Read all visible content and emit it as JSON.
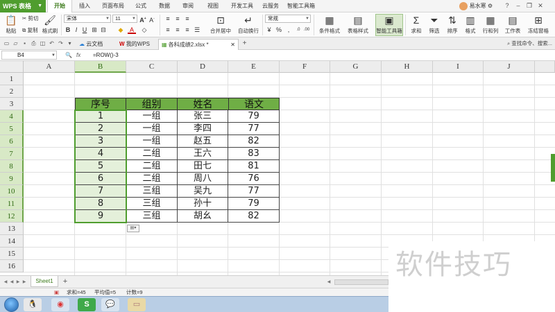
{
  "menubar": {
    "app_button": "WPS 表格",
    "tabs": [
      "开始",
      "插入",
      "页面布局",
      "公式",
      "数据",
      "审阅",
      "视图",
      "开发工具",
      "云服务",
      "智能工具箱"
    ],
    "active_tab": "开始",
    "user": "易水寒"
  },
  "ribbon": {
    "cut": "剪切",
    "copy": "复制",
    "paste": "粘贴",
    "format_painter": "格式刷",
    "font_name": "宋体",
    "font_size": "11",
    "number_format": "常规",
    "merge_center": "合并居中",
    "wrap_text": "自动换行",
    "cond_format": "条件格式",
    "table_style": "表格样式",
    "smart_toolbox": "智能工具箱",
    "sum": "求和",
    "filter": "筛选",
    "sort": "排序",
    "format": "格式",
    "row_col": "行和列",
    "worksheet": "工作表",
    "freeze": "冻结窗格"
  },
  "doc_tabs": {
    "cloud_doc": "云文档",
    "my_wps": "我的WPS",
    "active_file": "各科成绩2.xlsx *",
    "find_command": "查找命令、搜索..."
  },
  "formula_bar": {
    "name_box": "B4",
    "fx": "fx",
    "formula": "=ROW()-3"
  },
  "grid": {
    "columns": [
      "A",
      "B",
      "C",
      "D",
      "E",
      "F",
      "G",
      "H",
      "I",
      "J"
    ],
    "selected_column": "B",
    "rows": [
      "1",
      "2",
      "3",
      "4",
      "5",
      "6",
      "7",
      "8",
      "9",
      "10",
      "11",
      "12",
      "13",
      "14",
      "15",
      "16"
    ],
    "selected_rows": [
      "4",
      "5",
      "6",
      "7",
      "8",
      "9",
      "10",
      "11",
      "12"
    ]
  },
  "table": {
    "headers": [
      "序号",
      "组别",
      "姓名",
      "语文"
    ],
    "rows": [
      [
        "1",
        "一组",
        "张三",
        "79"
      ],
      [
        "2",
        "一组",
        "李四",
        "77"
      ],
      [
        "3",
        "一组",
        "赵五",
        "82"
      ],
      [
        "4",
        "二组",
        "王六",
        "83"
      ],
      [
        "5",
        "二组",
        "田七",
        "81"
      ],
      [
        "6",
        "二组",
        "周八",
        "76"
      ],
      [
        "7",
        "三组",
        "吴九",
        "77"
      ],
      [
        "8",
        "三组",
        "孙十",
        "79"
      ],
      [
        "9",
        "三组",
        "胡幺",
        "82"
      ]
    ]
  },
  "sheets": {
    "tabs": [
      "Sheet1"
    ],
    "add": "+"
  },
  "status": {
    "sum": "求和=45",
    "average": "平均值=5",
    "count": "计数=9"
  },
  "watermark": "软件技巧",
  "colors": {
    "accent": "#4f9d2e",
    "header_fill": "#6fae45",
    "selection_fill": "#e4f0da"
  }
}
